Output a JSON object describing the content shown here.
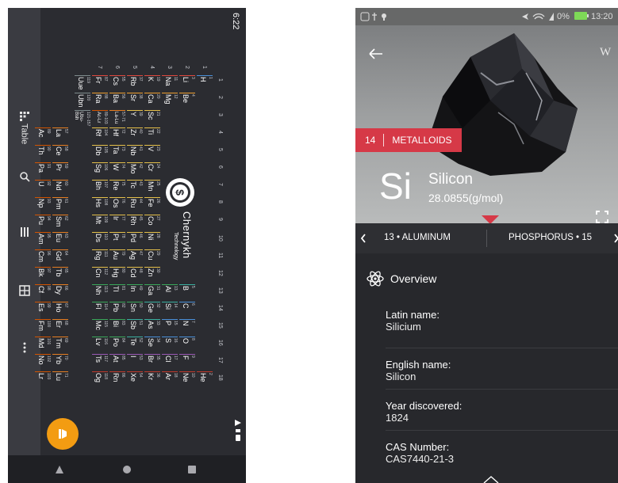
{
  "left_app": {
    "status_time": "6:22",
    "nav_rail": [
      {
        "label": "Table",
        "icon": "grid-icon"
      },
      {
        "label": "",
        "icon": "search-icon"
      },
      {
        "label": "",
        "icon": "list-icon"
      },
      {
        "label": "",
        "icon": "table-icon"
      },
      {
        "label": "",
        "icon": "more-vertical-icon"
      }
    ],
    "brand": {
      "name": "Chernykh",
      "sub": "Technology"
    },
    "group_numbers": [
      "1",
      "2",
      "3",
      "4",
      "5",
      "6",
      "7",
      "8",
      "9",
      "10",
      "11",
      "12",
      "13",
      "14",
      "15",
      "16",
      "17",
      "18"
    ],
    "period_numbers": [
      "1",
      "2",
      "3",
      "4",
      "5",
      "6",
      "7"
    ],
    "elements": [
      {
        "n": "1",
        "s": "H",
        "r": 1,
        "c": 1,
        "k": "nonmetal"
      },
      {
        "n": "2",
        "s": "He",
        "r": 1,
        "c": 18,
        "k": "noble"
      },
      {
        "n": "3",
        "s": "Li",
        "r": 2,
        "c": 1,
        "k": "alkali"
      },
      {
        "n": "4",
        "s": "Be",
        "r": 2,
        "c": 2,
        "k": "alkaline"
      },
      {
        "n": "5",
        "s": "B",
        "r": 2,
        "c": 13,
        "k": "metalloid"
      },
      {
        "n": "6",
        "s": "C",
        "r": 2,
        "c": 14,
        "k": "nonmetal"
      },
      {
        "n": "7",
        "s": "N",
        "r": 2,
        "c": 15,
        "k": "nonmetal"
      },
      {
        "n": "8",
        "s": "O",
        "r": 2,
        "c": 16,
        "k": "nonmetal"
      },
      {
        "n": "9",
        "s": "F",
        "r": 2,
        "c": 17,
        "k": "halogen"
      },
      {
        "n": "10",
        "s": "Ne",
        "r": 2,
        "c": 18,
        "k": "noble"
      },
      {
        "n": "11",
        "s": "Na",
        "r": 3,
        "c": 1,
        "k": "alkali"
      },
      {
        "n": "12",
        "s": "Mg",
        "r": 3,
        "c": 2,
        "k": "alkaline"
      },
      {
        "n": "13",
        "s": "Al",
        "r": 3,
        "c": 13,
        "k": "post"
      },
      {
        "n": "14",
        "s": "Si",
        "r": 3,
        "c": 14,
        "k": "metalloid"
      },
      {
        "n": "15",
        "s": "P",
        "r": 3,
        "c": 15,
        "k": "nonmetal"
      },
      {
        "n": "16",
        "s": "S",
        "r": 3,
        "c": 16,
        "k": "nonmetal"
      },
      {
        "n": "17",
        "s": "Cl",
        "r": 3,
        "c": 17,
        "k": "halogen"
      },
      {
        "n": "18",
        "s": "Ar",
        "r": 3,
        "c": 18,
        "k": "noble"
      },
      {
        "n": "19",
        "s": "K",
        "r": 4,
        "c": 1,
        "k": "alkali"
      },
      {
        "n": "20",
        "s": "Ca",
        "r": 4,
        "c": 2,
        "k": "alkaline"
      },
      {
        "n": "21",
        "s": "Sc",
        "r": 4,
        "c": 3,
        "k": "transition"
      },
      {
        "n": "22",
        "s": "Ti",
        "r": 4,
        "c": 4,
        "k": "transition"
      },
      {
        "n": "23",
        "s": "V",
        "r": 4,
        "c": 5,
        "k": "transition"
      },
      {
        "n": "24",
        "s": "Cr",
        "r": 4,
        "c": 6,
        "k": "transition"
      },
      {
        "n": "25",
        "s": "Mn",
        "r": 4,
        "c": 7,
        "k": "transition"
      },
      {
        "n": "26",
        "s": "Fe",
        "r": 4,
        "c": 8,
        "k": "transition"
      },
      {
        "n": "27",
        "s": "Co",
        "r": 4,
        "c": 9,
        "k": "transition"
      },
      {
        "n": "28",
        "s": "Ni",
        "r": 4,
        "c": 10,
        "k": "transition"
      },
      {
        "n": "29",
        "s": "Cu",
        "r": 4,
        "c": 11,
        "k": "transition"
      },
      {
        "n": "30",
        "s": "Zn",
        "r": 4,
        "c": 12,
        "k": "transition"
      },
      {
        "n": "31",
        "s": "Ga",
        "r": 4,
        "c": 13,
        "k": "post"
      },
      {
        "n": "32",
        "s": "Ge",
        "r": 4,
        "c": 14,
        "k": "metalloid"
      },
      {
        "n": "33",
        "s": "As",
        "r": 4,
        "c": 15,
        "k": "metalloid"
      },
      {
        "n": "34",
        "s": "Se",
        "r": 4,
        "c": 16,
        "k": "nonmetal"
      },
      {
        "n": "35",
        "s": "Br",
        "r": 4,
        "c": 17,
        "k": "halogen"
      },
      {
        "n": "36",
        "s": "Kr",
        "r": 4,
        "c": 18,
        "k": "noble"
      },
      {
        "n": "37",
        "s": "Rb",
        "r": 5,
        "c": 1,
        "k": "alkali"
      },
      {
        "n": "38",
        "s": "Sr",
        "r": 5,
        "c": 2,
        "k": "alkaline"
      },
      {
        "n": "39",
        "s": "Y",
        "r": 5,
        "c": 3,
        "k": "transition"
      },
      {
        "n": "40",
        "s": "Zr",
        "r": 5,
        "c": 4,
        "k": "transition"
      },
      {
        "n": "41",
        "s": "Nb",
        "r": 5,
        "c": 5,
        "k": "transition"
      },
      {
        "n": "42",
        "s": "Mo",
        "r": 5,
        "c": 6,
        "k": "transition"
      },
      {
        "n": "43",
        "s": "Tc",
        "r": 5,
        "c": 7,
        "k": "transition"
      },
      {
        "n": "44",
        "s": "Ru",
        "r": 5,
        "c": 8,
        "k": "transition"
      },
      {
        "n": "45",
        "s": "Rh",
        "r": 5,
        "c": 9,
        "k": "transition"
      },
      {
        "n": "46",
        "s": "Pd",
        "r": 5,
        "c": 10,
        "k": "transition"
      },
      {
        "n": "47",
        "s": "Ag",
        "r": 5,
        "c": 11,
        "k": "transition"
      },
      {
        "n": "48",
        "s": "Cd",
        "r": 5,
        "c": 12,
        "k": "transition"
      },
      {
        "n": "49",
        "s": "In",
        "r": 5,
        "c": 13,
        "k": "post"
      },
      {
        "n": "50",
        "s": "Sn",
        "r": 5,
        "c": 14,
        "k": "post"
      },
      {
        "n": "51",
        "s": "Sb",
        "r": 5,
        "c": 15,
        "k": "metalloid"
      },
      {
        "n": "52",
        "s": "Te",
        "r": 5,
        "c": 16,
        "k": "metalloid"
      },
      {
        "n": "53",
        "s": "I",
        "r": 5,
        "c": 17,
        "k": "halogen"
      },
      {
        "n": "54",
        "s": "Xe",
        "r": 5,
        "c": 18,
        "k": "noble"
      },
      {
        "n": "55",
        "s": "Cs",
        "r": 6,
        "c": 1,
        "k": "alkali"
      },
      {
        "n": "56",
        "s": "Ba",
        "r": 6,
        "c": 2,
        "k": "alkaline"
      },
      {
        "n": "57-71",
        "s": "La-Lu",
        "r": 6,
        "c": 3,
        "k": "lanthanide"
      },
      {
        "n": "72",
        "s": "Hf",
        "r": 6,
        "c": 4,
        "k": "transition"
      },
      {
        "n": "73",
        "s": "Ta",
        "r": 6,
        "c": 5,
        "k": "transition"
      },
      {
        "n": "74",
        "s": "W",
        "r": 6,
        "c": 6,
        "k": "transition"
      },
      {
        "n": "75",
        "s": "Re",
        "r": 6,
        "c": 7,
        "k": "transition"
      },
      {
        "n": "76",
        "s": "Os",
        "r": 6,
        "c": 8,
        "k": "transition"
      },
      {
        "n": "77",
        "s": "Ir",
        "r": 6,
        "c": 9,
        "k": "transition"
      },
      {
        "n": "78",
        "s": "Pt",
        "r": 6,
        "c": 10,
        "k": "transition"
      },
      {
        "n": "79",
        "s": "Au",
        "r": 6,
        "c": 11,
        "k": "transition"
      },
      {
        "n": "80",
        "s": "Hg",
        "r": 6,
        "c": 12,
        "k": "transition"
      },
      {
        "n": "81",
        "s": "Tl",
        "r": 6,
        "c": 13,
        "k": "post"
      },
      {
        "n": "82",
        "s": "Pb",
        "r": 6,
        "c": 14,
        "k": "post"
      },
      {
        "n": "83",
        "s": "Bi",
        "r": 6,
        "c": 15,
        "k": "post"
      },
      {
        "n": "84",
        "s": "Po",
        "r": 6,
        "c": 16,
        "k": "post"
      },
      {
        "n": "85",
        "s": "At",
        "r": 6,
        "c": 17,
        "k": "halogen"
      },
      {
        "n": "86",
        "s": "Rn",
        "r": 6,
        "c": 18,
        "k": "noble"
      },
      {
        "n": "87",
        "s": "Fr",
        "r": 7,
        "c": 1,
        "k": "alkali"
      },
      {
        "n": "88",
        "s": "Ra",
        "r": 7,
        "c": 2,
        "k": "alkaline"
      },
      {
        "n": "89-103",
        "s": "Ac-Lr",
        "r": 7,
        "c": 3,
        "k": "actinide"
      },
      {
        "n": "104",
        "s": "Rf",
        "r": 7,
        "c": 4,
        "k": "transition"
      },
      {
        "n": "105",
        "s": "Db",
        "r": 7,
        "c": 5,
        "k": "transition"
      },
      {
        "n": "106",
        "s": "Sg",
        "r": 7,
        "c": 6,
        "k": "transition"
      },
      {
        "n": "107",
        "s": "Bh",
        "r": 7,
        "c": 7,
        "k": "transition"
      },
      {
        "n": "108",
        "s": "Hs",
        "r": 7,
        "c": 8,
        "k": "transition"
      },
      {
        "n": "109",
        "s": "Mt",
        "r": 7,
        "c": 9,
        "k": "transition"
      },
      {
        "n": "110",
        "s": "Ds",
        "r": 7,
        "c": 10,
        "k": "transition"
      },
      {
        "n": "111",
        "s": "Rg",
        "r": 7,
        "c": 11,
        "k": "transition"
      },
      {
        "n": "112",
        "s": "Cn",
        "r": 7,
        "c": 12,
        "k": "transition"
      },
      {
        "n": "113",
        "s": "Nh",
        "r": 7,
        "c": 13,
        "k": "post"
      },
      {
        "n": "114",
        "s": "Fl",
        "r": 7,
        "c": 14,
        "k": "post"
      },
      {
        "n": "115",
        "s": "Mc",
        "r": 7,
        "c": 15,
        "k": "post"
      },
      {
        "n": "116",
        "s": "Lv",
        "r": 7,
        "c": 16,
        "k": "post"
      },
      {
        "n": "117",
        "s": "Ts",
        "r": 7,
        "c": 17,
        "k": "halogen"
      },
      {
        "n": "118",
        "s": "Og",
        "r": 7,
        "c": 18,
        "k": "noble"
      },
      {
        "n": "119",
        "s": "Uue",
        "r": 8,
        "c": 1,
        "k": "unknown"
      },
      {
        "n": "120",
        "s": "Ubn",
        "r": 8,
        "c": 2,
        "k": "unknown"
      },
      {
        "n": "121-157",
        "s": "Ubu-Bsh",
        "r": 8,
        "c": 3,
        "k": "unknown"
      },
      {
        "n": "57",
        "s": "La",
        "r": 9,
        "c": 4,
        "k": "lanthanide"
      },
      {
        "n": "58",
        "s": "Ce",
        "r": 9,
        "c": 5,
        "k": "lanthanide"
      },
      {
        "n": "59",
        "s": "Pr",
        "r": 9,
        "c": 6,
        "k": "lanthanide"
      },
      {
        "n": "60",
        "s": "Nd",
        "r": 9,
        "c": 7,
        "k": "lanthanide"
      },
      {
        "n": "61",
        "s": "Pm",
        "r": 9,
        "c": 8,
        "k": "lanthanide"
      },
      {
        "n": "62",
        "s": "Sm",
        "r": 9,
        "c": 9,
        "k": "lanthanide"
      },
      {
        "n": "63",
        "s": "Eu",
        "r": 9,
        "c": 10,
        "k": "lanthanide"
      },
      {
        "n": "64",
        "s": "Gd",
        "r": 9,
        "c": 11,
        "k": "lanthanide"
      },
      {
        "n": "65",
        "s": "Tb",
        "r": 9,
        "c": 12,
        "k": "lanthanide"
      },
      {
        "n": "66",
        "s": "Dy",
        "r": 9,
        "c": 13,
        "k": "lanthanide"
      },
      {
        "n": "67",
        "s": "Ho",
        "r": 9,
        "c": 14,
        "k": "lanthanide"
      },
      {
        "n": "68",
        "s": "Er",
        "r": 9,
        "c": 15,
        "k": "lanthanide"
      },
      {
        "n": "69",
        "s": "Tm",
        "r": 9,
        "c": 16,
        "k": "lanthanide"
      },
      {
        "n": "70",
        "s": "Yb",
        "r": 9,
        "c": 17,
        "k": "lanthanide"
      },
      {
        "n": "71",
        "s": "Lu",
        "r": 9,
        "c": 18,
        "k": "lanthanide"
      },
      {
        "n": "89",
        "s": "Ac",
        "r": 10,
        "c": 4,
        "k": "actinide"
      },
      {
        "n": "90",
        "s": "Th",
        "r": 10,
        "c": 5,
        "k": "actinide"
      },
      {
        "n": "91",
        "s": "Pa",
        "r": 10,
        "c": 6,
        "k": "actinide"
      },
      {
        "n": "92",
        "s": "U",
        "r": 10,
        "c": 7,
        "k": "actinide"
      },
      {
        "n": "93",
        "s": "Np",
        "r": 10,
        "c": 8,
        "k": "actinide"
      },
      {
        "n": "94",
        "s": "Pu",
        "r": 10,
        "c": 9,
        "k": "actinide"
      },
      {
        "n": "95",
        "s": "Am",
        "r": 10,
        "c": 10,
        "k": "actinide"
      },
      {
        "n": "96",
        "s": "Cm",
        "r": 10,
        "c": 11,
        "k": "actinide"
      },
      {
        "n": "97",
        "s": "Bk",
        "r": 10,
        "c": 12,
        "k": "actinide"
      },
      {
        "n": "98",
        "s": "Cf",
        "r": 10,
        "c": 13,
        "k": "actinide"
      },
      {
        "n": "99",
        "s": "Es",
        "r": 10,
        "c": 14,
        "k": "actinide"
      },
      {
        "n": "100",
        "s": "Fm",
        "r": 10,
        "c": 15,
        "k": "actinide"
      },
      {
        "n": "101",
        "s": "Md",
        "r": 10,
        "c": 16,
        "k": "actinide"
      },
      {
        "n": "102",
        "s": "No",
        "r": 10,
        "c": 17,
        "k": "actinide"
      },
      {
        "n": "103",
        "s": "Lr",
        "r": 10,
        "c": 18,
        "k": "actinide"
      }
    ],
    "category_colors": {
      "alkali": "#e0483f",
      "alkaline": "#f0a030",
      "transition": "#e5c04a",
      "post": "#3aa85a",
      "metalloid": "#3ab0a0",
      "nonmetal": "#4a90d9",
      "halogen": "#9b59b6",
      "noble": "#c0392b",
      "lanthanide": "#e67e22",
      "actinide": "#d35400",
      "unknown": "#7f8c8d"
    },
    "fab_color": "#f39c12"
  },
  "right_app": {
    "status": {
      "battery": "0%",
      "time": "13:20"
    },
    "back_icon": "arrow-left-icon",
    "wiki_label": "W",
    "element": {
      "number": "14",
      "category": "METALLOIDS",
      "symbol": "Si",
      "name": "Silicon",
      "mass": "28.0855(g/mol)"
    },
    "accent": "#d63947",
    "prev": {
      "label": "13 • ALUMINUM"
    },
    "next": {
      "label": "PHOSPHORUS • 15"
    },
    "section": {
      "title": "Overview",
      "icon": "atom-icon"
    },
    "info": [
      {
        "label": "Latin name:",
        "value": "Silicium"
      },
      {
        "label": "English name:",
        "value": "Silicon"
      },
      {
        "label": "Year discovered:",
        "value": "1824"
      },
      {
        "label": "CAS Number:",
        "value": "CAS7440-21-3"
      }
    ]
  }
}
